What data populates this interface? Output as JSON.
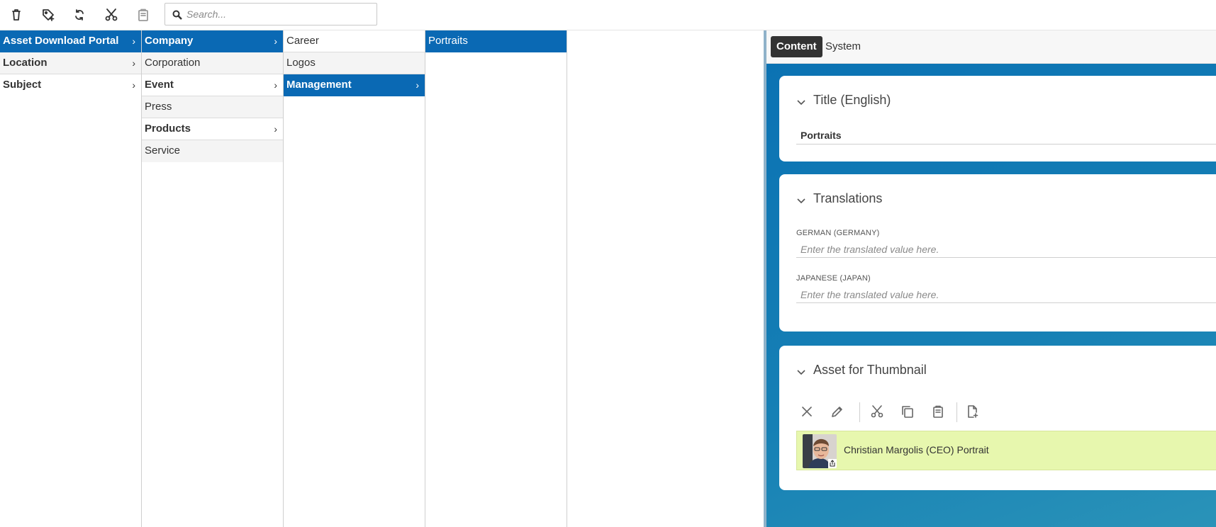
{
  "toolbar": {
    "buttons": [
      {
        "icon": "trash-icon",
        "enabled": true
      },
      {
        "icon": "tag-add-icon",
        "enabled": true
      },
      {
        "icon": "refresh-icon",
        "enabled": true
      },
      {
        "icon": "scissors-icon",
        "enabled": true
      },
      {
        "icon": "clipboard-icon",
        "enabled": false
      }
    ],
    "search_placeholder": "Search..."
  },
  "columns": [
    {
      "items": [
        {
          "label": "Asset Download Portal",
          "selected": true,
          "has_children": true
        },
        {
          "label": "Location",
          "has_children": true
        },
        {
          "label": "Subject",
          "has_children": true
        }
      ]
    },
    {
      "items": [
        {
          "label": "Company",
          "selected": true,
          "has_children": true
        },
        {
          "label": "Corporation",
          "has_children": false
        },
        {
          "label": "Event",
          "has_children": true
        },
        {
          "label": "Press",
          "has_children": false
        },
        {
          "label": "Products",
          "has_children": true
        },
        {
          "label": "Service",
          "has_children": false
        }
      ]
    },
    {
      "items": [
        {
          "label": "Career",
          "has_children": false
        },
        {
          "label": "Logos",
          "has_children": false
        },
        {
          "label": "Management",
          "selected": true,
          "has_children": true
        }
      ]
    },
    {
      "items": [
        {
          "label": "Portraits",
          "selected": true,
          "has_children": false
        }
      ]
    }
  ],
  "panel": {
    "tabs": {
      "content": "Content",
      "system": "System"
    },
    "title_section": {
      "heading": "Title (English)",
      "value": "Portraits"
    },
    "translations_section": {
      "heading": "Translations",
      "german_label": "GERMAN (GERMANY)",
      "german_placeholder": "Enter the translated value here.",
      "japanese_label": "JAPANESE (JAPAN)",
      "japanese_placeholder": "Enter the translated value here."
    },
    "asset_section": {
      "heading": "Asset for Thumbnail",
      "tool_icons": [
        "close-icon",
        "pencil-icon",
        "scissors-icon",
        "copy-icon",
        "clipboard-icon",
        "file-add-icon"
      ],
      "asset_name": "Christian Margolis (CEO) Portrait"
    }
  },
  "colors": {
    "selected": "#0a69b4",
    "panel": "#0a71b3",
    "asset_highlight": "#e7f7ae"
  }
}
